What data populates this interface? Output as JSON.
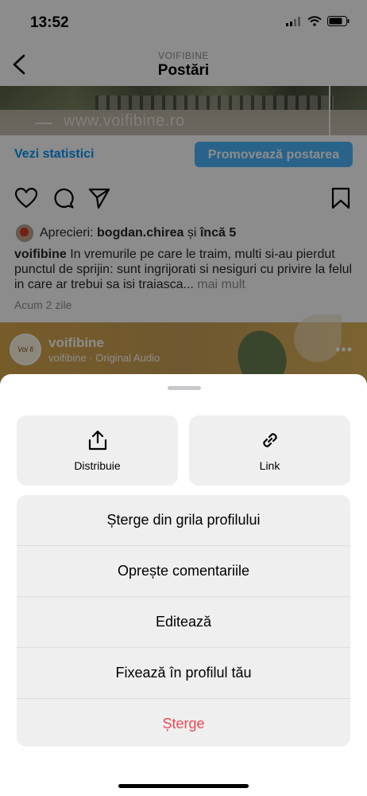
{
  "status_bar": {
    "time": "13:52",
    "icons": [
      "signal-icon",
      "wifi-icon",
      "battery-icon"
    ]
  },
  "header": {
    "subtitle": "VOIFIBINE",
    "title": "Postări"
  },
  "post": {
    "image_watermark": "www.voifibine.ro",
    "stats_link": "Vezi statistici",
    "promote_button": "Promovează postarea",
    "likes": {
      "prefix": "Aprecieri:",
      "user": "bogdan.chirea",
      "and": "și",
      "others": "încă 5"
    },
    "caption": {
      "author": "voifibine",
      "text": "In vremurile pe care le traim, multi si-au pierdut punctul de sprijin: sunt ingrijorati si nesiguri cu privire la felul in care ar trebui sa isi traiasca...",
      "more": "mai mult"
    },
    "time_ago": "Acum 2 zile"
  },
  "next_post": {
    "avatar_text": "Voi fi bine",
    "name": "voifibine",
    "audio": "voifibine · Original Audio"
  },
  "sheet": {
    "share_label": "Distribuie",
    "link_label": "Link",
    "items": [
      {
        "label": "Șterge din grila profilului"
      },
      {
        "label": "Oprește comentariile"
      },
      {
        "label": "Editează"
      },
      {
        "label": "Fixează în profilul tău"
      },
      {
        "label": "Șterge"
      }
    ]
  },
  "colors": {
    "accent": "#0095f6",
    "danger": "#ed4956",
    "sheet_bg": "#ffffff",
    "button_bg": "#efefef"
  }
}
